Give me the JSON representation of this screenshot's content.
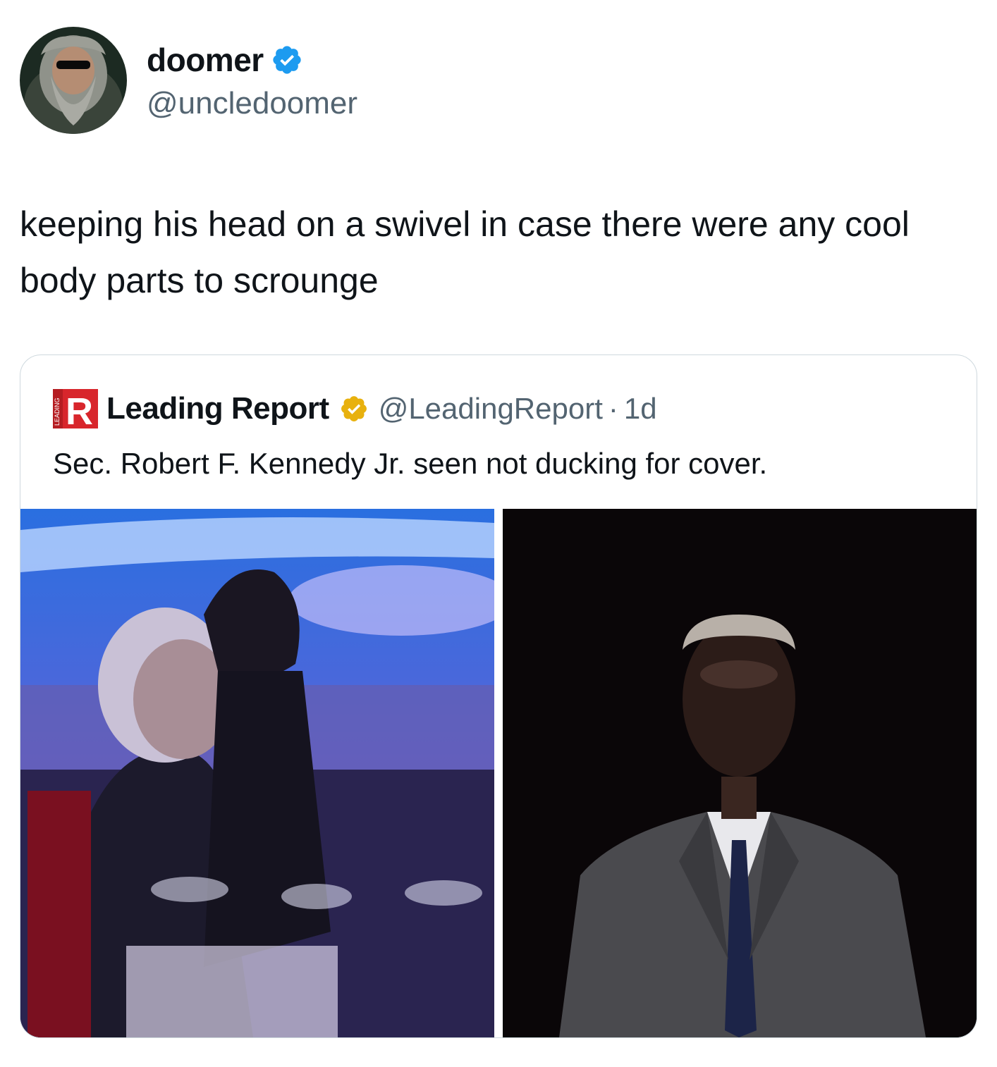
{
  "tweet": {
    "author": {
      "display_name": "doomer",
      "handle": "@uncledoomer",
      "verified": true,
      "avatar_icon": "bearded-man-sunglasses-avatar"
    },
    "text": "keeping his head on a swivel in case there were any cool body parts to scrounge"
  },
  "quoted_tweet": {
    "author": {
      "display_name": "Leading Report",
      "handle": "@LeadingReport",
      "separator": "·",
      "time": "1d",
      "verified": true,
      "verified_color": "#e8b10e",
      "logo_letter": "R",
      "logo_side_text": "LEADING",
      "logo_color": "#d8262c"
    },
    "text": "Sec. Robert F. Kennedy Jr. seen not ducking for cover.",
    "media": [
      {
        "description_icon": "banquet-hall-photo"
      },
      {
        "description_icon": "man-in-suit-dark-photo"
      }
    ]
  },
  "colors": {
    "verified_blue": "#1d9bf0",
    "secondary_text": "#536471",
    "border": "#cfd9de"
  }
}
